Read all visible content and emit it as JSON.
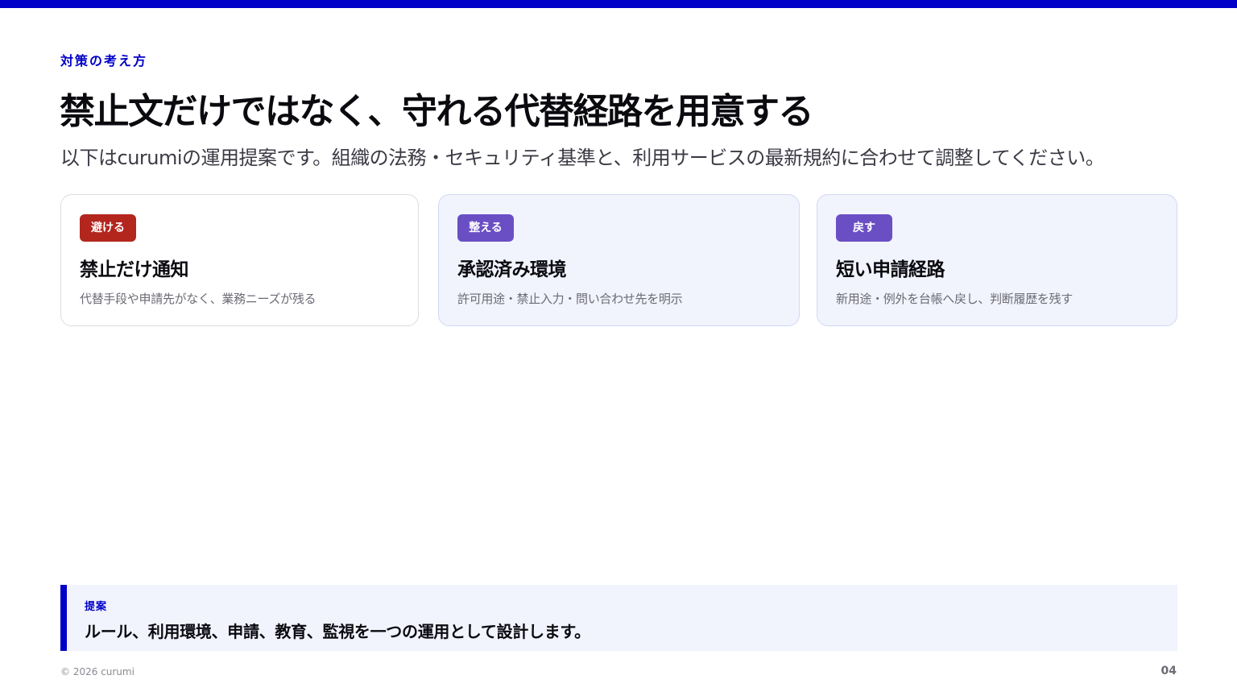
{
  "eyebrow": "対策の考え方",
  "title": "禁止文だけではなく、守れる代替経路を用意する",
  "subtitle": "以下はcurumiの運用提案です。組織の法務・セキュリティ基準と、利用サービスの最新規約に合わせて調整してください。",
  "cards": [
    {
      "badge": "避ける",
      "title": "禁止だけ通知",
      "description": "代替手段や申請先がなく、業務ニーズが残る"
    },
    {
      "badge": "整える",
      "title": "承認済み環境",
      "description": "許可用途・禁止入力・問い合わせ先を明示"
    },
    {
      "badge": "戻す",
      "title": "短い申請経路",
      "description": "新用途・例外を台帳へ戻し、判断履歴を残す"
    }
  ],
  "callout": {
    "label": "提案",
    "text": "ルール、利用環境、申請、教育、監視を一つの運用として設計します。"
  },
  "footer": {
    "copyright": "© 2026 curumi",
    "page_number": "04"
  },
  "colors": {
    "accent": "#0000c8",
    "badge_avoid": "#b3261e",
    "badge_other": "#6a4fc4",
    "tint": "#f1f3fd"
  }
}
